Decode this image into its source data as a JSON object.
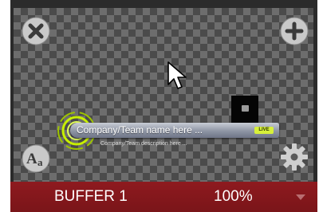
{
  "colors": {
    "status_bar": "#8e1a1f",
    "accent_ring": "#c8f000",
    "checker_dark": "#4b4b4b",
    "checker_light": "#6d6d6d"
  },
  "icons": {
    "close": "close-icon",
    "add": "plus-icon",
    "font": "font-size-icon",
    "settings": "gear-icon",
    "cursor": "mouse-pointer-icon",
    "dropdown": "chevron-down-icon"
  },
  "lower_third": {
    "title": "Company/Team name here ...",
    "badge": "LIVE",
    "subtitle": "Company/Team description here ..."
  },
  "status": {
    "buffer_label": "BUFFER 1",
    "zoom": "100%"
  }
}
